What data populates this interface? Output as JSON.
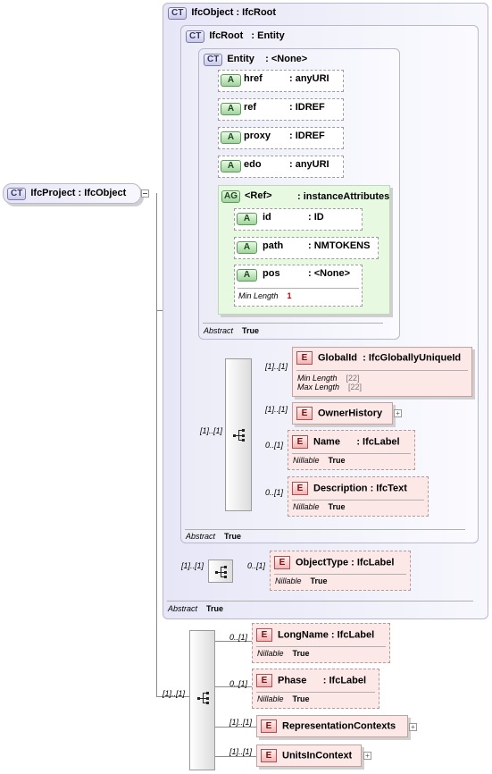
{
  "root": {
    "badge": "CT",
    "name": "IfcProject",
    "type": ": IfcObject"
  },
  "ifcobject": {
    "badge": "CT",
    "title": "IfcObject : IfcRoot",
    "abstract_label": "Abstract",
    "abstract_value": "True"
  },
  "ifcroot": {
    "badge": "CT",
    "name": "IfcRoot",
    "type": ": Entity",
    "abstract_label": "Abstract",
    "abstract_value": "True"
  },
  "entity": {
    "badge": "CT",
    "name": "Entity",
    "type": ": <None>",
    "abstract_label": "Abstract",
    "abstract_value": "True"
  },
  "attributes": [
    {
      "badge": "A",
      "name": "href",
      "type": ": anyURI"
    },
    {
      "badge": "A",
      "name": "ref",
      "type": ": IDREF"
    },
    {
      "badge": "A",
      "name": "proxy",
      "type": ": IDREF"
    },
    {
      "badge": "A",
      "name": "edo",
      "type": ": anyURI"
    }
  ],
  "attribute_group": {
    "badge": "AG",
    "name": "<Ref>",
    "type": ": instanceAttributes",
    "items": [
      {
        "badge": "A",
        "name": "id",
        "type": ": ID"
      },
      {
        "badge": "A",
        "name": "path",
        "type": ": NMTOKENS"
      },
      {
        "badge": "A",
        "name": "pos",
        "type": ": <None>",
        "prop_label": "Min Length",
        "prop_value": "1"
      }
    ]
  },
  "root_elements": [
    {
      "badge": "E",
      "name": "GlobalId",
      "type": ": IfcGloballyUniqueId",
      "card": "[1]..[1]",
      "props": [
        {
          "label": "Min Length",
          "value": "[22]"
        },
        {
          "label": "Max Length",
          "value": "[22]"
        }
      ]
    },
    {
      "badge": "E",
      "name": "OwnerHistory",
      "card": "[1]..[1]"
    },
    {
      "badge": "E",
      "name": "Name",
      "type": ": IfcLabel",
      "card": "0..[1]",
      "prop_label": "Nillable",
      "prop_value": "True"
    },
    {
      "badge": "E",
      "name": "Description",
      "type": ": IfcText",
      "card": "0..[1]",
      "prop_label": "Nillable",
      "prop_value": "True"
    }
  ],
  "ifcroot_seq_card": "[1]..[1]",
  "object_seq_card": "[1]..[1]",
  "objecttype": {
    "badge": "E",
    "name": "ObjectType",
    "type": ": IfcLabel",
    "card": "0..[1]",
    "prop_label": "Nillable",
    "prop_value": "True"
  },
  "project_seq_card": "[1]..[1]",
  "project_elements": [
    {
      "badge": "E",
      "name": "LongName",
      "type": ": IfcLabel",
      "card": "0..[1]",
      "prop_label": "Nillable",
      "prop_value": "True"
    },
    {
      "badge": "E",
      "name": "Phase",
      "type": ": IfcLabel",
      "card": "0..[1]",
      "prop_label": "Nillable",
      "prop_value": "True"
    },
    {
      "badge": "E",
      "name": "RepresentationContexts",
      "card": "[1]..[1]"
    },
    {
      "badge": "E",
      "name": "UnitsInContext",
      "card": "[1]..[1]"
    }
  ]
}
